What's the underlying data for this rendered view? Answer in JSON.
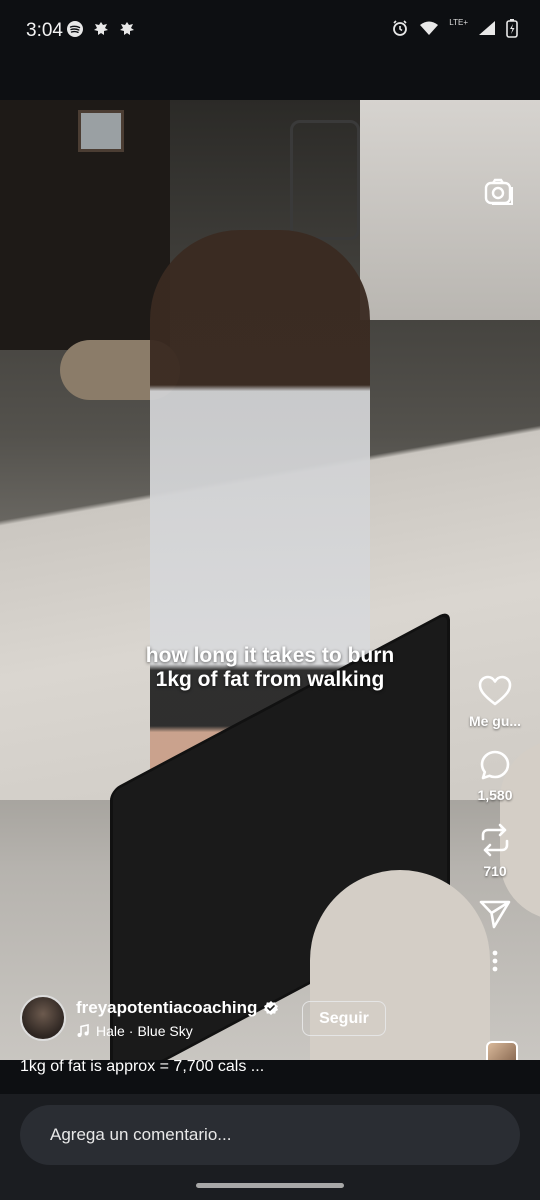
{
  "status_bar": {
    "time": "3:04",
    "network": "LTE+"
  },
  "video": {
    "caption_line1": "how long it takes to burn",
    "caption_line2": "1kg of fat from walking"
  },
  "actions": {
    "like_label": "Me gu...",
    "comments_count": "1,580",
    "reposts_count": "710"
  },
  "author": {
    "username": "freyapotentiacoaching",
    "verified": true,
    "music_artist": "Hale",
    "music_track": "Blue Sky",
    "follow_label": "Seguir"
  },
  "description": "1kg of fat is approx = 7,700 cals ...",
  "comment_input": {
    "placeholder": "Agrega un comentario..."
  },
  "colors": {
    "background": "#000000",
    "bar": "#0d0f12",
    "comment_box": "#2a2d33"
  }
}
